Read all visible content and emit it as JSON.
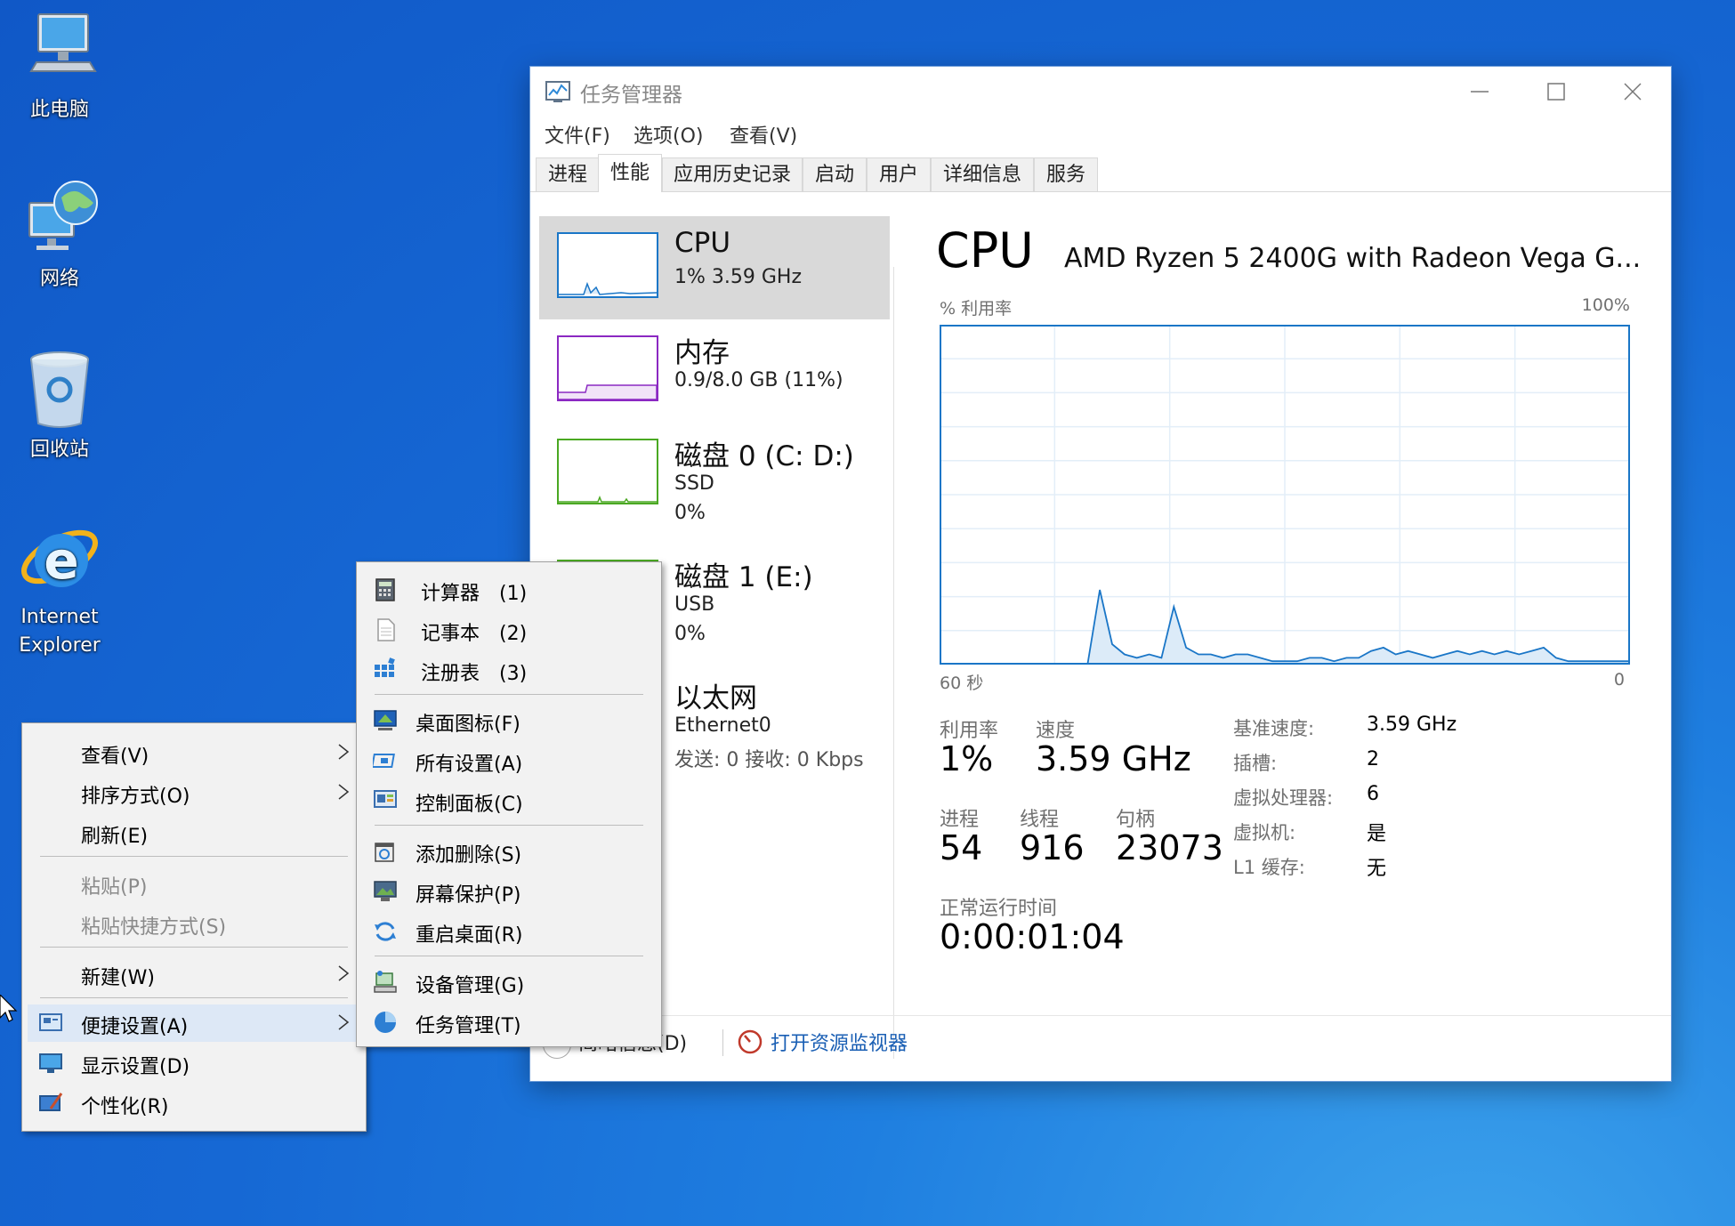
{
  "desktop": {
    "icons": [
      {
        "label": "此电脑"
      },
      {
        "label": "网络"
      },
      {
        "label": "回收站"
      },
      {
        "label_line1": "Internet",
        "label_line2": "Explorer"
      }
    ]
  },
  "task_manager": {
    "title": "任务管理器",
    "menu": [
      "文件(F)",
      "选项(O)",
      "查看(V)"
    ],
    "tabs": [
      "进程",
      "性能",
      "应用历史记录",
      "启动",
      "用户",
      "详细信息",
      "服务"
    ],
    "active_tab": "性能",
    "sidebar": [
      {
        "title": "CPU",
        "line1": "1% 3.59 GHz",
        "color": "#1a76c7"
      },
      {
        "title": "内存",
        "line1": "0.9/8.0 GB (11%)",
        "color": "#8b28c2"
      },
      {
        "title": "磁盘 0 (C: D:)",
        "line1": "SSD",
        "line2": "0%",
        "color": "#4aa822"
      },
      {
        "title": "磁盘 1 (E:)",
        "line1": "USB",
        "line2": "0%",
        "color": "#4aa822"
      },
      {
        "title": "以太网",
        "line1": "Ethernet0",
        "line2": "发送: 0 接收: 0 Kbps"
      }
    ],
    "detail": {
      "title": "CPU",
      "cpu_name": "AMD Ryzen 5 2400G with Radeon Vega G...",
      "graph_label": "% 利用率",
      "graph_max": "100%",
      "graph_time_left": "60 秒",
      "graph_time_right": "0",
      "stats": {
        "util_label": "利用率",
        "util_value": "1%",
        "speed_label": "速度",
        "speed_value": "3.59 GHz",
        "proc_label": "进程",
        "proc_value": "54",
        "thread_label": "线程",
        "thread_value": "916",
        "handle_label": "句柄",
        "handle_value": "23073",
        "uptime_label": "正常运行时间",
        "uptime_value": "0:00:01:04"
      },
      "specs": [
        {
          "k": "基准速度:",
          "v": "3.59 GHz"
        },
        {
          "k": "插槽:",
          "v": "2"
        },
        {
          "k": "虚拟处理器:",
          "v": "6"
        },
        {
          "k": "虚拟机:",
          "v": "是"
        },
        {
          "k": "L1 缓存:",
          "v": "无"
        }
      ],
      "cpu_history": [
        0,
        0,
        0,
        0,
        0,
        0,
        0,
        0,
        0,
        0,
        0,
        0,
        0,
        22,
        6,
        3,
        2,
        3,
        2,
        17,
        5,
        3,
        3,
        2,
        3,
        3,
        2,
        1,
        1,
        1,
        2,
        2,
        1,
        2,
        2,
        4,
        5,
        3,
        4,
        3,
        2,
        3,
        4,
        3,
        4,
        3,
        4,
        3,
        4,
        5,
        2,
        1,
        1,
        1,
        1,
        1,
        1
      ]
    },
    "footer": {
      "fewer_details": "简略信息(D)",
      "resource_monitor": "打开资源监视器"
    }
  },
  "context_menu": {
    "items": [
      {
        "label": "查看(V)"
      },
      {
        "label": "排序方式(O)"
      },
      {
        "label": "刷新(E)"
      },
      {
        "label": "粘贴(P)"
      },
      {
        "label": "粘贴快捷方式(S)"
      },
      {
        "label": "新建(W)"
      },
      {
        "label": "便捷设置(A)"
      },
      {
        "label": "显示设置(D)"
      },
      {
        "label": "个性化(R)"
      }
    ]
  },
  "submenu": {
    "items": [
      {
        "label": "计算器　(1)"
      },
      {
        "label": "记事本　(2)"
      },
      {
        "label": "注册表　(3)"
      },
      {
        "label": "桌面图标(F)"
      },
      {
        "label": "所有设置(A)"
      },
      {
        "label": "控制面板(C)"
      },
      {
        "label": "添加删除(S)"
      },
      {
        "label": "屏幕保护(P)"
      },
      {
        "label": "重启桌面(R)"
      },
      {
        "label": "设备管理(G)"
      },
      {
        "label": "任务管理(T)"
      }
    ]
  }
}
